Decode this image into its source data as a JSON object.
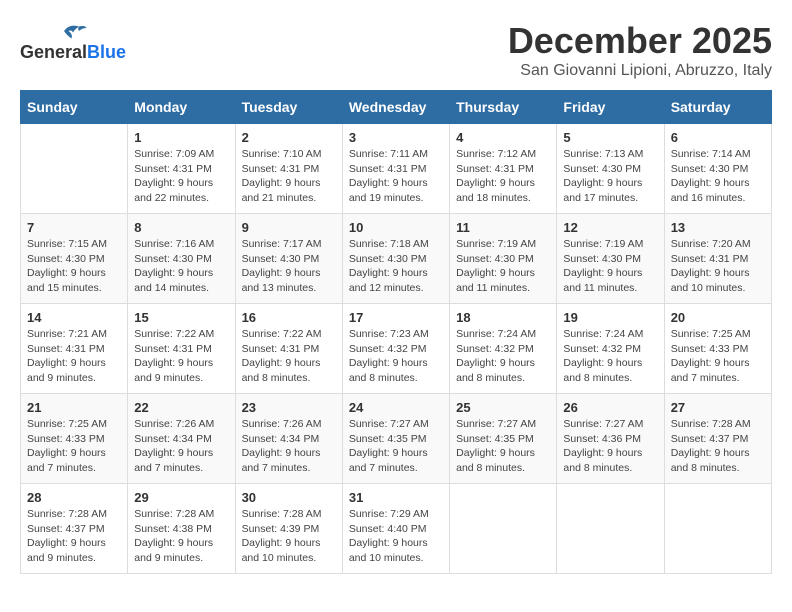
{
  "logo": {
    "general": "General",
    "blue": "Blue"
  },
  "title": {
    "month": "December 2025",
    "location": "San Giovanni Lipioni, Abruzzo, Italy"
  },
  "headers": [
    "Sunday",
    "Monday",
    "Tuesday",
    "Wednesday",
    "Thursday",
    "Friday",
    "Saturday"
  ],
  "weeks": [
    [
      {
        "day": "",
        "sunrise": "",
        "sunset": "",
        "daylight": ""
      },
      {
        "day": "1",
        "sunrise": "Sunrise: 7:09 AM",
        "sunset": "Sunset: 4:31 PM",
        "daylight": "Daylight: 9 hours and 22 minutes."
      },
      {
        "day": "2",
        "sunrise": "Sunrise: 7:10 AM",
        "sunset": "Sunset: 4:31 PM",
        "daylight": "Daylight: 9 hours and 21 minutes."
      },
      {
        "day": "3",
        "sunrise": "Sunrise: 7:11 AM",
        "sunset": "Sunset: 4:31 PM",
        "daylight": "Daylight: 9 hours and 19 minutes."
      },
      {
        "day": "4",
        "sunrise": "Sunrise: 7:12 AM",
        "sunset": "Sunset: 4:31 PM",
        "daylight": "Daylight: 9 hours and 18 minutes."
      },
      {
        "day": "5",
        "sunrise": "Sunrise: 7:13 AM",
        "sunset": "Sunset: 4:30 PM",
        "daylight": "Daylight: 9 hours and 17 minutes."
      },
      {
        "day": "6",
        "sunrise": "Sunrise: 7:14 AM",
        "sunset": "Sunset: 4:30 PM",
        "daylight": "Daylight: 9 hours and 16 minutes."
      }
    ],
    [
      {
        "day": "7",
        "sunrise": "Sunrise: 7:15 AM",
        "sunset": "Sunset: 4:30 PM",
        "daylight": "Daylight: 9 hours and 15 minutes."
      },
      {
        "day": "8",
        "sunrise": "Sunrise: 7:16 AM",
        "sunset": "Sunset: 4:30 PM",
        "daylight": "Daylight: 9 hours and 14 minutes."
      },
      {
        "day": "9",
        "sunrise": "Sunrise: 7:17 AM",
        "sunset": "Sunset: 4:30 PM",
        "daylight": "Daylight: 9 hours and 13 minutes."
      },
      {
        "day": "10",
        "sunrise": "Sunrise: 7:18 AM",
        "sunset": "Sunset: 4:30 PM",
        "daylight": "Daylight: 9 hours and 12 minutes."
      },
      {
        "day": "11",
        "sunrise": "Sunrise: 7:19 AM",
        "sunset": "Sunset: 4:30 PM",
        "daylight": "Daylight: 9 hours and 11 minutes."
      },
      {
        "day": "12",
        "sunrise": "Sunrise: 7:19 AM",
        "sunset": "Sunset: 4:30 PM",
        "daylight": "Daylight: 9 hours and 11 minutes."
      },
      {
        "day": "13",
        "sunrise": "Sunrise: 7:20 AM",
        "sunset": "Sunset: 4:31 PM",
        "daylight": "Daylight: 9 hours and 10 minutes."
      }
    ],
    [
      {
        "day": "14",
        "sunrise": "Sunrise: 7:21 AM",
        "sunset": "Sunset: 4:31 PM",
        "daylight": "Daylight: 9 hours and 9 minutes."
      },
      {
        "day": "15",
        "sunrise": "Sunrise: 7:22 AM",
        "sunset": "Sunset: 4:31 PM",
        "daylight": "Daylight: 9 hours and 9 minutes."
      },
      {
        "day": "16",
        "sunrise": "Sunrise: 7:22 AM",
        "sunset": "Sunset: 4:31 PM",
        "daylight": "Daylight: 9 hours and 8 minutes."
      },
      {
        "day": "17",
        "sunrise": "Sunrise: 7:23 AM",
        "sunset": "Sunset: 4:32 PM",
        "daylight": "Daylight: 9 hours and 8 minutes."
      },
      {
        "day": "18",
        "sunrise": "Sunrise: 7:24 AM",
        "sunset": "Sunset: 4:32 PM",
        "daylight": "Daylight: 9 hours and 8 minutes."
      },
      {
        "day": "19",
        "sunrise": "Sunrise: 7:24 AM",
        "sunset": "Sunset: 4:32 PM",
        "daylight": "Daylight: 9 hours and 8 minutes."
      },
      {
        "day": "20",
        "sunrise": "Sunrise: 7:25 AM",
        "sunset": "Sunset: 4:33 PM",
        "daylight": "Daylight: 9 hours and 7 minutes."
      }
    ],
    [
      {
        "day": "21",
        "sunrise": "Sunrise: 7:25 AM",
        "sunset": "Sunset: 4:33 PM",
        "daylight": "Daylight: 9 hours and 7 minutes."
      },
      {
        "day": "22",
        "sunrise": "Sunrise: 7:26 AM",
        "sunset": "Sunset: 4:34 PM",
        "daylight": "Daylight: 9 hours and 7 minutes."
      },
      {
        "day": "23",
        "sunrise": "Sunrise: 7:26 AM",
        "sunset": "Sunset: 4:34 PM",
        "daylight": "Daylight: 9 hours and 7 minutes."
      },
      {
        "day": "24",
        "sunrise": "Sunrise: 7:27 AM",
        "sunset": "Sunset: 4:35 PM",
        "daylight": "Daylight: 9 hours and 7 minutes."
      },
      {
        "day": "25",
        "sunrise": "Sunrise: 7:27 AM",
        "sunset": "Sunset: 4:35 PM",
        "daylight": "Daylight: 9 hours and 8 minutes."
      },
      {
        "day": "26",
        "sunrise": "Sunrise: 7:27 AM",
        "sunset": "Sunset: 4:36 PM",
        "daylight": "Daylight: 9 hours and 8 minutes."
      },
      {
        "day": "27",
        "sunrise": "Sunrise: 7:28 AM",
        "sunset": "Sunset: 4:37 PM",
        "daylight": "Daylight: 9 hours and 8 minutes."
      }
    ],
    [
      {
        "day": "28",
        "sunrise": "Sunrise: 7:28 AM",
        "sunset": "Sunset: 4:37 PM",
        "daylight": "Daylight: 9 hours and 9 minutes."
      },
      {
        "day": "29",
        "sunrise": "Sunrise: 7:28 AM",
        "sunset": "Sunset: 4:38 PM",
        "daylight": "Daylight: 9 hours and 9 minutes."
      },
      {
        "day": "30",
        "sunrise": "Sunrise: 7:28 AM",
        "sunset": "Sunset: 4:39 PM",
        "daylight": "Daylight: 9 hours and 10 minutes."
      },
      {
        "day": "31",
        "sunrise": "Sunrise: 7:29 AM",
        "sunset": "Sunset: 4:40 PM",
        "daylight": "Daylight: 9 hours and 10 minutes."
      },
      {
        "day": "",
        "sunrise": "",
        "sunset": "",
        "daylight": ""
      },
      {
        "day": "",
        "sunrise": "",
        "sunset": "",
        "daylight": ""
      },
      {
        "day": "",
        "sunrise": "",
        "sunset": "",
        "daylight": ""
      }
    ]
  ]
}
